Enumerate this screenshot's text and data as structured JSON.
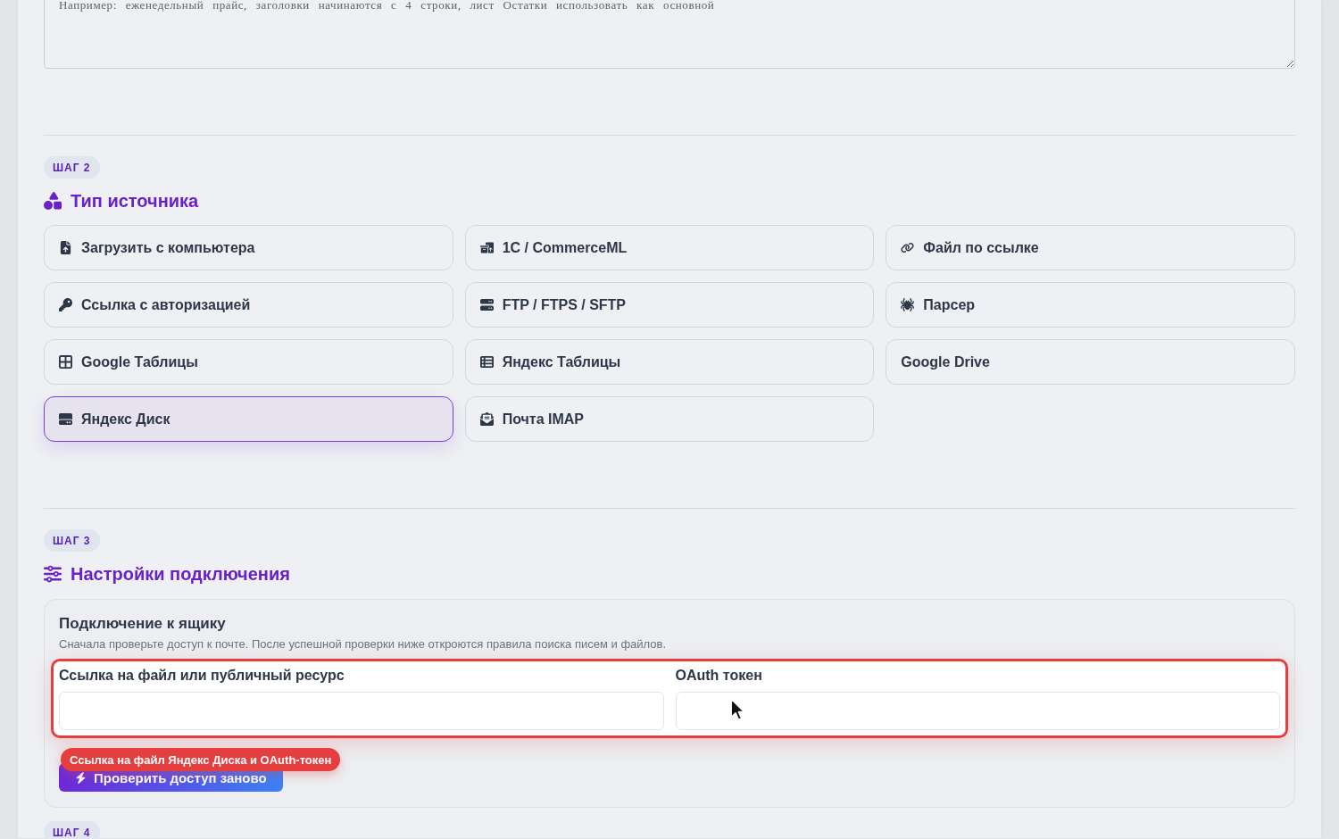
{
  "notes_field": {
    "placeholder": "Например: еженедельный прайс, заголовки начинаются с 4 строки, лист Остатки использовать как основной"
  },
  "source_step": {
    "badge": "ШАГ 2",
    "title": "Тип источника",
    "sources": [
      {
        "label": "Загрузить с компьютера",
        "selected": false
      },
      {
        "label": "1C / CommerceML",
        "selected": false
      },
      {
        "label": "Файл по ссылке",
        "selected": false
      },
      {
        "label": "Ссылка с авторизацией",
        "selected": false
      },
      {
        "label": "FTP / FTPS / SFTP",
        "selected": false
      },
      {
        "label": "Парсер",
        "selected": false
      },
      {
        "label": "Google Таблицы",
        "selected": false
      },
      {
        "label": "Яндекс Таблицы",
        "selected": false
      },
      {
        "label": "Google Drive",
        "selected": false
      },
      {
        "label": "Яндекс Диск",
        "selected": true
      },
      {
        "label": "Почта IMAP",
        "selected": false
      }
    ]
  },
  "connection_step": {
    "badge": "ШАГ 3",
    "title": "Настройки подключения",
    "card": {
      "title": "Подключение к ящику",
      "hint": "Сначала проверьте доступ к почте. После успешной проверки ниже откроются правила поиска писем и файлов.",
      "fields_invalid": true,
      "fields": [
        {
          "label": "Ссылка на файл или публичный ресурс"
        },
        {
          "label": "OAuth токен"
        }
      ],
      "error_tooltip": "Ссылка на файл Яндекс Диска и OAuth-токен",
      "check_button": "Проверить доступ заново"
    }
  },
  "next_step": {
    "badge": "ШАГ 4"
  }
}
